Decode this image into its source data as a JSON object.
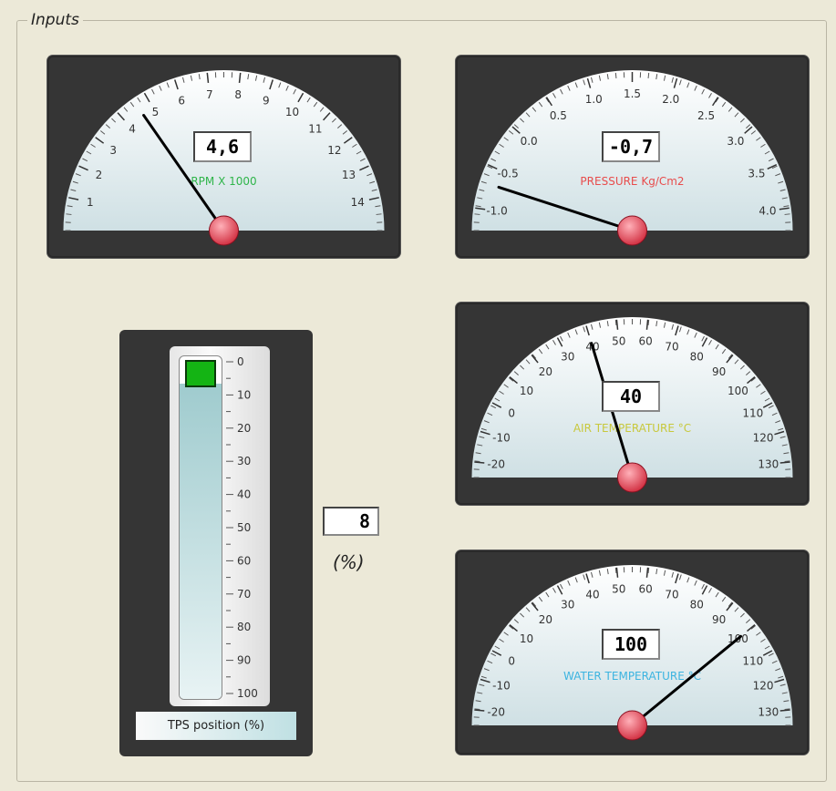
{
  "group": {
    "title": "Inputs"
  },
  "gauges": [
    {
      "id": "rpm",
      "label": "RPM X 1000",
      "label_color": "#2fb54a",
      "value_text": "4,6",
      "value": 4.6,
      "min": 0,
      "max": 15,
      "ticks": [
        {
          "v": 1,
          "t": "1"
        },
        {
          "v": 2,
          "t": "2"
        },
        {
          "v": 3,
          "t": "3"
        },
        {
          "v": 4,
          "t": "4"
        },
        {
          "v": 5,
          "t": "5"
        },
        {
          "v": 6,
          "t": "6"
        },
        {
          "v": 7,
          "t": "7"
        },
        {
          "v": 8,
          "t": "8"
        },
        {
          "v": 9,
          "t": "9"
        },
        {
          "v": 10,
          "t": "10"
        },
        {
          "v": 11,
          "t": "11"
        },
        {
          "v": 12,
          "t": "12"
        },
        {
          "v": 13,
          "t": "13"
        },
        {
          "v": 14,
          "t": "14"
        }
      ]
    },
    {
      "id": "pressure",
      "label": "PRESSURE Kg/Cm2",
      "label_color": "#e84c4c",
      "value_text": "-0,7",
      "value": -0.7,
      "min": -1.25,
      "max": 4.25,
      "ticks": [
        {
          "v": -1.0,
          "t": "-1.0"
        },
        {
          "v": -0.5,
          "t": "-0.5"
        },
        {
          "v": 0.0,
          "t": "0.0"
        },
        {
          "v": 0.5,
          "t": "0.5"
        },
        {
          "v": 1.0,
          "t": "1.0"
        },
        {
          "v": 1.5,
          "t": "1.5"
        },
        {
          "v": 2.0,
          "t": "2.0"
        },
        {
          "v": 2.5,
          "t": "2.5"
        },
        {
          "v": 3.0,
          "t": "3.0"
        },
        {
          "v": 3.5,
          "t": "3.5"
        },
        {
          "v": 4.0,
          "t": "4.0"
        }
      ]
    },
    {
      "id": "air",
      "label": "AIR TEMPERATURE °C",
      "label_color": "#c8c83c",
      "value_text": "40",
      "value": 40,
      "min": -25,
      "max": 135,
      "ticks": [
        {
          "v": -20,
          "t": "-20"
        },
        {
          "v": -10,
          "t": "-10"
        },
        {
          "v": 0,
          "t": "0"
        },
        {
          "v": 10,
          "t": "10"
        },
        {
          "v": 20,
          "t": "20"
        },
        {
          "v": 30,
          "t": "30"
        },
        {
          "v": 40,
          "t": "40"
        },
        {
          "v": 50,
          "t": "50"
        },
        {
          "v": 60,
          "t": "60"
        },
        {
          "v": 70,
          "t": "70"
        },
        {
          "v": 80,
          "t": "80"
        },
        {
          "v": 90,
          "t": "90"
        },
        {
          "v": 100,
          "t": "100"
        },
        {
          "v": 110,
          "t": "110"
        },
        {
          "v": 120,
          "t": "120"
        },
        {
          "v": 130,
          "t": "130"
        }
      ]
    },
    {
      "id": "water",
      "label": "WATER TEMPERATURE °C",
      "label_color": "#3cb4e0",
      "value_text": "100",
      "value": 100,
      "min": -25,
      "max": 135,
      "ticks": [
        {
          "v": -20,
          "t": "-20"
        },
        {
          "v": -10,
          "t": "-10"
        },
        {
          "v": 0,
          "t": "0"
        },
        {
          "v": 10,
          "t": "10"
        },
        {
          "v": 20,
          "t": "20"
        },
        {
          "v": 30,
          "t": "30"
        },
        {
          "v": 40,
          "t": "40"
        },
        {
          "v": 50,
          "t": "50"
        },
        {
          "v": 60,
          "t": "60"
        },
        {
          "v": 70,
          "t": "70"
        },
        {
          "v": 80,
          "t": "80"
        },
        {
          "v": 90,
          "t": "90"
        },
        {
          "v": 100,
          "t": "100"
        },
        {
          "v": 110,
          "t": "110"
        },
        {
          "v": 120,
          "t": "120"
        },
        {
          "v": 130,
          "t": "130"
        }
      ]
    }
  ],
  "tps": {
    "label": "TPS position (%)",
    "value_text": "8",
    "unit": "(%)",
    "value": 8,
    "scale": [
      "0",
      "10",
      "20",
      "30",
      "40",
      "50",
      "60",
      "70",
      "80",
      "90",
      "100"
    ]
  },
  "colors": {
    "panel": "#353535",
    "needle_hub": "#e04050",
    "background": "#ECE9D8",
    "tps_handle": "#14b414"
  }
}
